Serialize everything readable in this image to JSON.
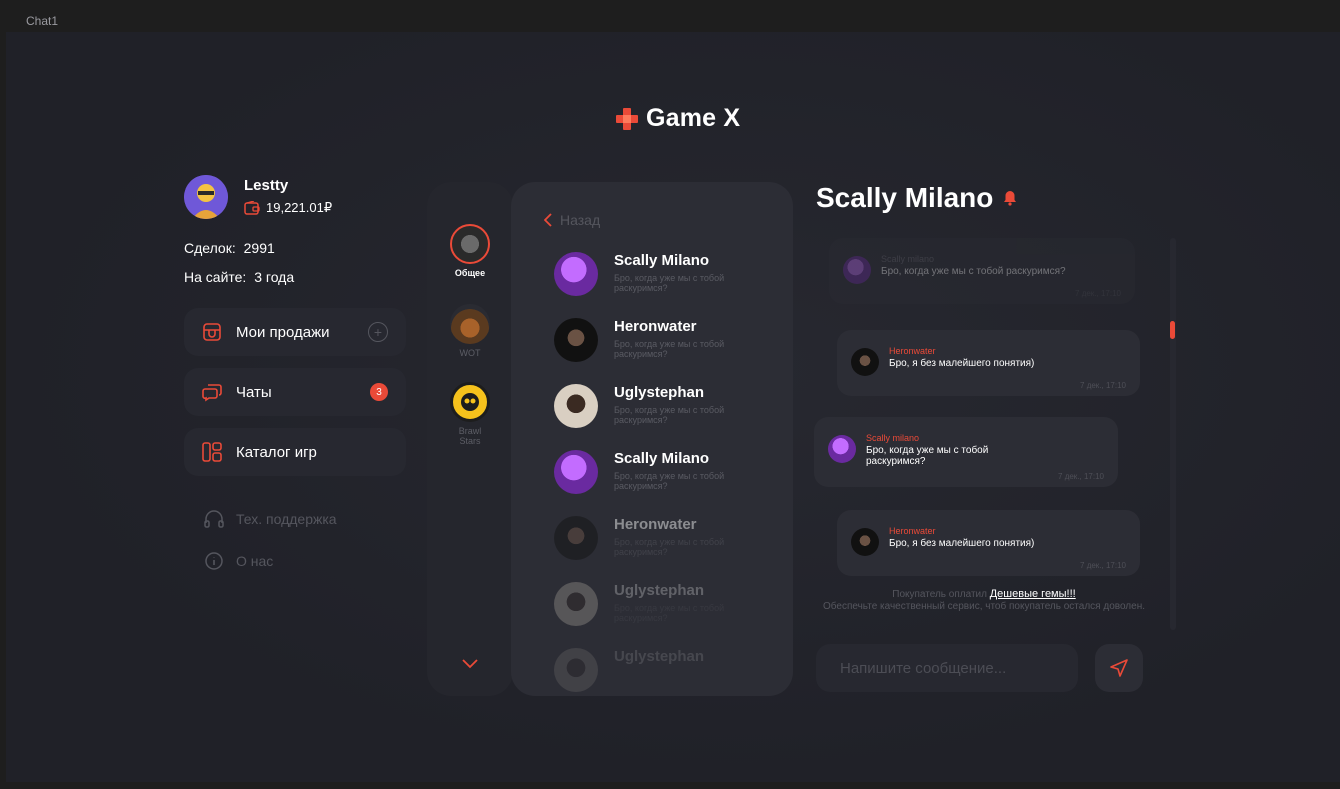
{
  "window": {
    "title": "Chat1"
  },
  "brand": {
    "name": "Game X",
    "accent": "#ea4a38"
  },
  "profile": {
    "username": "Lestty",
    "balance": "19,221.01₽",
    "deals_label": "Сделок:",
    "deals_value": "2991",
    "on_site_label": "На сайте:",
    "on_site_value": "3 года"
  },
  "menu": {
    "sales": "Мои продажи",
    "chats": "Чаты",
    "chats_badge": "3",
    "catalog": "Каталог игр",
    "support": "Тех. поддержка",
    "about": "О нас"
  },
  "games": [
    {
      "label": "Общее",
      "icon": "general-game-icon",
      "active": true
    },
    {
      "label": "WOT",
      "icon": "wot-tank-icon",
      "active": false
    },
    {
      "label": "Brawl Stars",
      "icon": "brawl-stars-skull-icon",
      "active": false
    }
  ],
  "chat_list": {
    "back_label": "Назад",
    "items": [
      {
        "name": "Scally Milano",
        "preview": "Бро, когда уже мы с тобой раскуримся?"
      },
      {
        "name": "Heronwater",
        "preview": "Бро, когда уже мы с тобой раскуримся?"
      },
      {
        "name": "Uglystephan",
        "preview": "Бро, когда уже мы с тобой раскуримся?"
      },
      {
        "name": "Scally Milano",
        "preview": "Бро, когда уже мы с тобой раскуримся?"
      },
      {
        "name": "Heronwater",
        "preview": "Бро, когда уже мы с тобой раскуримся?"
      },
      {
        "name": "Uglystephan",
        "preview": "Бро, когда уже мы с тобой раскуримся?"
      },
      {
        "name": "Uglystephan",
        "preview": ""
      }
    ]
  },
  "conversation": {
    "title": "Scally Milano",
    "messages": [
      {
        "author": "Scally milano",
        "text": "Бро, когда уже мы с тобой раскуримся?",
        "time": "7 дек., 17:10"
      },
      {
        "author": "Heronwater",
        "text": "Бро, я без малейшего понятия)",
        "time": "7 дек., 17:10"
      },
      {
        "author": "Scally milano",
        "text": "Бро, когда уже мы с тобой раскуримся?",
        "time": "7 дек., 17:10"
      },
      {
        "author": "Heronwater",
        "text": "Бро, я без малейшего понятия)",
        "time": "7 дек., 17:10"
      }
    ],
    "notice_prefix": "Покупатель оплатил",
    "notice_link": "Дешевые гемы!!!",
    "notice_suffix": "Обеспечьте качественный сервис, чтоб покупатель остался доволен.",
    "input_placeholder": "Напишите сообщение..."
  }
}
